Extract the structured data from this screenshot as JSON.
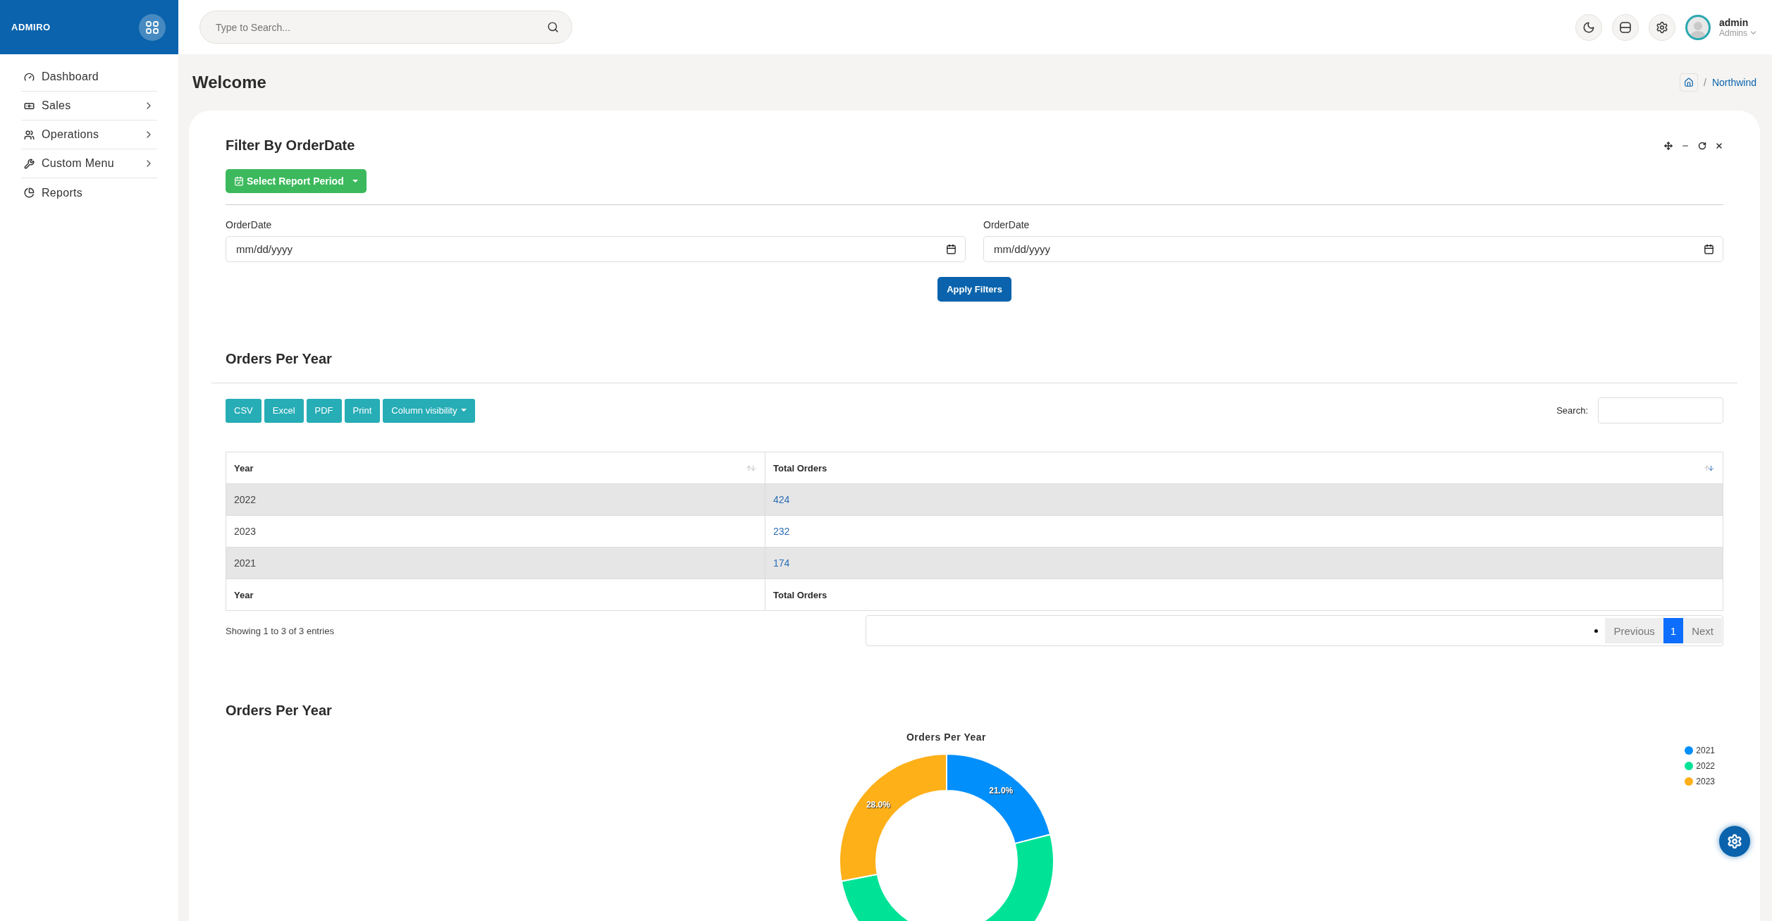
{
  "brand": {
    "logo": "ADMIRO"
  },
  "header": {
    "search": {
      "placeholder": "Type to Search..."
    },
    "user": {
      "name": "admin",
      "role": "Admins"
    }
  },
  "sidebar": {
    "items": [
      {
        "label": "Dashboard",
        "has_submenu": false
      },
      {
        "label": "Sales",
        "has_submenu": true
      },
      {
        "label": "Operations",
        "has_submenu": true
      },
      {
        "label": "Custom Menu",
        "has_submenu": true
      },
      {
        "label": "Reports",
        "has_submenu": false
      }
    ]
  },
  "page": {
    "title": "Welcome",
    "breadcrumb_separator": "/",
    "breadcrumb": [
      "Northwind"
    ]
  },
  "filter": {
    "title": "Filter By OrderDate",
    "period_button": "Select Report Period",
    "fields": [
      {
        "label": "OrderDate",
        "placeholder": "mm/dd/yyyy"
      },
      {
        "label": "OrderDate",
        "placeholder": "mm/dd/yyyy"
      }
    ],
    "apply_button": "Apply Filters"
  },
  "table_section": {
    "title": "Orders Per Year",
    "export_buttons": [
      "CSV",
      "Excel",
      "PDF",
      "Print"
    ],
    "column_visibility": "Column visibility",
    "search_label": "Search:",
    "columns": [
      {
        "label": "Year",
        "sorted": false
      },
      {
        "label": "Total Orders",
        "sorted": true
      }
    ],
    "rows": [
      [
        "2022",
        "424"
      ],
      [
        "2023",
        "232"
      ],
      [
        "2021",
        "174"
      ]
    ],
    "footer": [
      "Year",
      "Total Orders"
    ],
    "info": "Showing 1 to 3 of 3 entries",
    "pagination": [
      {
        "label": "Previous",
        "selected": false
      },
      {
        "label": "1",
        "selected": true
      },
      {
        "label": "Next",
        "selected": false
      }
    ]
  },
  "chart_section": {
    "title": "Orders Per Year",
    "chart_data": {
      "type": "donut",
      "title": "Orders Per Year",
      "categories": [
        "2021",
        "2022",
        "2023"
      ],
      "values": [
        21.0,
        51.0,
        28.0
      ],
      "colors": [
        "#008ffb",
        "#00e396",
        "#feb019"
      ],
      "value_labels": [
        "21.0%",
        null,
        "28.0%"
      ]
    }
  }
}
